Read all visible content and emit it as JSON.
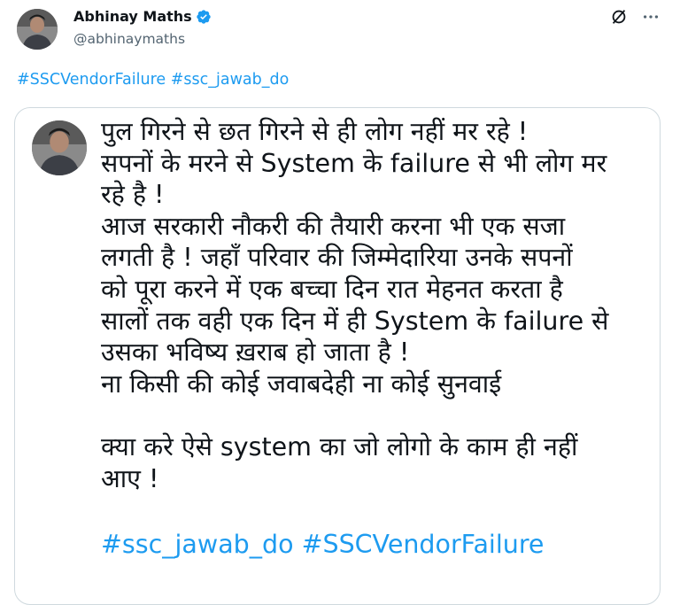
{
  "post": {
    "author_name": "Abhinay Maths",
    "author_handle": "@abhinaymaths",
    "verified": true,
    "hashtags": [
      "#SSCVendorFailure",
      "#ssc_jawab_do"
    ]
  },
  "quote": {
    "lines": [
      "पुल गिरने से छत गिरने से ही लोग नहीं मर रहे !",
      "सपनों के मरने से System के failure से भी लोग मर",
      "रहे है !",
      "आज सरकारी नौकरी की तैयारी करना भी एक सजा",
      "लगती है ! जहाँ परिवार की जिम्मेदारिया उनके सपनों",
      "को पूरा करने में एक बच्चा दिन रात मेहनत करता है",
      "सालों तक वही एक दिन में ही System के failure से",
      "उसका भविष्य ख़राब हो जाता है !",
      "ना किसी की कोई जवाबदेही ना कोई सुनवाई",
      "",
      "क्या करे ऐसे system का जो लोगो के काम ही नहीं",
      "आए !"
    ],
    "hashtags": [
      "#ssc_jawab_do",
      "#SSCVendorFailure"
    ]
  },
  "icons": {
    "header_right": [
      "grok-icon",
      "more-options-icon"
    ],
    "verified": "verified-badge-icon"
  },
  "colors": {
    "link": "#1d9bf0",
    "text": "#0f1419",
    "muted": "#536471",
    "border": "#cfd9de"
  }
}
